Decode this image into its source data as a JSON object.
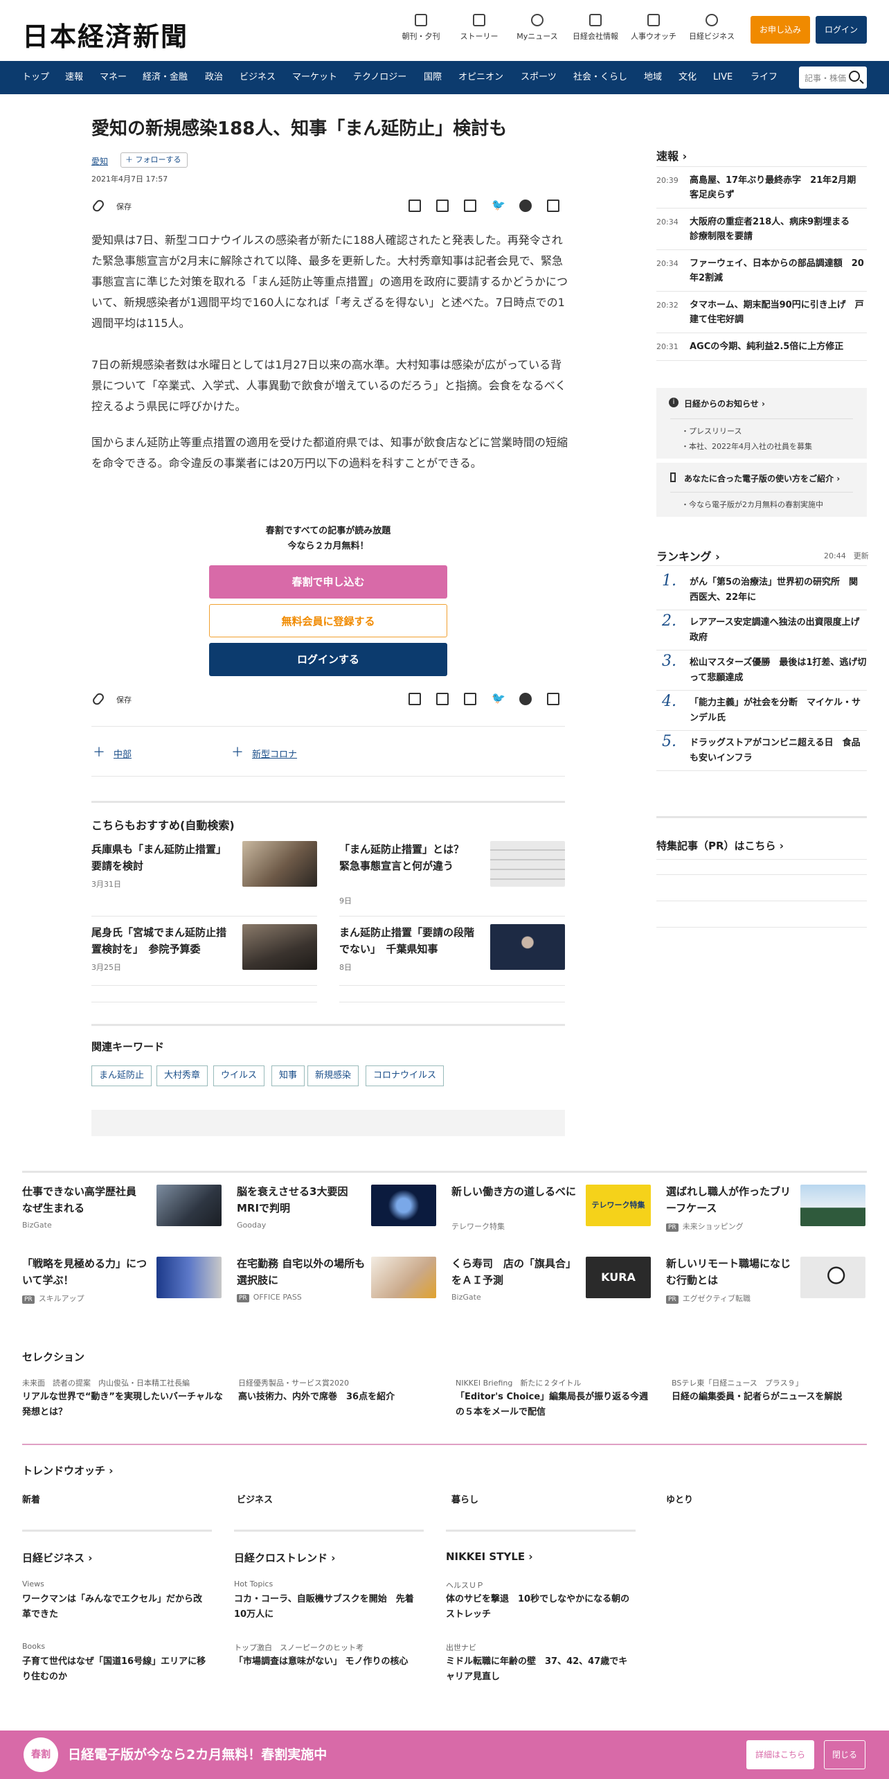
{
  "header": {
    "logo": "日本経済新聞",
    "icons": [
      {
        "label": "朝刊・夕刊"
      },
      {
        "label": "ストーリー"
      },
      {
        "label": "Myニュース"
      },
      {
        "label": "日経会社情報"
      },
      {
        "label": "人事ウオッチ"
      },
      {
        "label": "日経ビジネス"
      }
    ],
    "apply_label": "お申し込み",
    "login_label": "ログイン"
  },
  "nav": {
    "items": [
      "トップ",
      "速報",
      "マネー",
      "経済・金融",
      "政治",
      "ビジネス",
      "マーケット",
      "テクノロジー",
      "国際",
      "オピニオン",
      "スポーツ",
      "社会・くらし",
      "地域",
      "文化",
      "LIVE",
      "ライフ"
    ],
    "search_placeholder": "記事・株価"
  },
  "article": {
    "headline": "愛知の新規感染188人、知事「まん延防止」検討も",
    "topic": "愛知",
    "follow": "フォローする",
    "date": "2021年4月7日 17:57",
    "save": "保存",
    "paragraphs": [
      "愛知県は7日、新型コロナウイルスの感染者が新たに188人確認されたと発表した。再発令された緊急事態宣言が2月末に解除されて以降、最多を更新した。大村秀章知事は記者会見で、緊急事態宣言に準じた対策を取れる「まん延防止等重点措置」の適用を政府に要請するかどうかについて、新規感染者が1週間平均で160人になれば「考えざるを得ない」と述べた。7日時点での1週間平均は115人。",
      "7日の新規感染者数は水曜日としては1月27日以来の高水準。大村知事は感染が広がっている背景について「卒業式、入学式、人事異動で飲食が増えているのだろう」と指摘。会食をなるべく控えるよう県民に呼びかけた。",
      "国からまん延防止等重点措置の適用を受けた都道府県では、知事が飲食店などに営業時間の短縮を命令できる。命令違反の事業者には20万円以下の過料を科すことができる。"
    ],
    "paywall": {
      "line1": "春割ですべての記事が読み放題",
      "line2": "今なら２カ月無料！",
      "btn1": "春割で申し込む",
      "btn2": "無料会員に登録する",
      "btn3": "ログインする"
    },
    "topics": [
      "中部",
      "新型コロナ"
    ]
  },
  "recommend": {
    "title": "こちらもおすすめ(自動検索)",
    "items": [
      {
        "title": "兵庫県も「まん延防止措置」要請を検討",
        "date": "3月31日"
      },
      {
        "title": "「まん延防止措置」とは？　緊急事態宣言と何が違う",
        "date": "9日"
      },
      {
        "title": "尾身氏「宮城でまん延防止措置検討を」　参院予算委",
        "date": "3月25日"
      },
      {
        "title": "まん延防止措置「要請の段階でない」　千葉県知事",
        "date": "8日"
      }
    ]
  },
  "keywords": {
    "title": "関連キーワード",
    "items": [
      "まん延防止",
      "大村秀章",
      "ウイルス",
      "知事",
      "新規感染",
      "コロナウイルス"
    ]
  },
  "sidebar": {
    "news_title": "速報",
    "news": [
      {
        "time": "20:39",
        "text": "高島屋、17年ぶり最終赤字　21年2月期　客足戻らず"
      },
      {
        "time": "20:34",
        "text": "大阪府の重症者218人、病床9割埋まる　診療制限を要請"
      },
      {
        "time": "20:34",
        "text": "ファーウェイ、日本からの部品調達額　20年2割減"
      },
      {
        "time": "20:32",
        "text": "タマホーム、期末配当90円に引き上げ　戸建て住宅好調"
      },
      {
        "time": "20:31",
        "text": "AGCの今期、純利益2.5倍に上方修正"
      }
    ],
    "notice": {
      "title": "日経からのお知らせ",
      "items": [
        "プレスリリース",
        "本社、2022年4月入社の社員を募集"
      ]
    },
    "guide": {
      "title": "あなたに合った電子版の使い方をご紹介",
      "items": [
        "今なら電子版が2カ月無料の春割実施中"
      ]
    },
    "ranking_title": "ランキング",
    "ranking_time": "20:44",
    "ranking_update": "更新",
    "ranking": [
      {
        "num": "1.",
        "text": "がん「第5の治療法」世界初の研究所　関西医大、22年に"
      },
      {
        "num": "2.",
        "text": "レアアース安定調達へ独法の出資限度上げ　政府"
      },
      {
        "num": "3.",
        "text": "松山マスターズ優勝　最後は1打差、逃げ切って悲願達成"
      },
      {
        "num": "4.",
        "text": "「能力主義」が社会を分断　マイケル・サンデル氏"
      },
      {
        "num": "5.",
        "text": "ドラッグストアがコンビニ超える日　食品も安いインフラ"
      }
    ],
    "special": "特集記事（PR）はこちら"
  },
  "ads": [
    {
      "title": "仕事できない高学歴社員　なぜ生まれる",
      "src": "BizGate",
      "pr": false
    },
    {
      "title": "脳を衰えさせる3大要因　MRIで判明",
      "src": "Gooday",
      "pr": false
    },
    {
      "title": "新しい働き方の道しるべに",
      "src": "テレワーク特集",
      "pr": false
    },
    {
      "title": "選ばれし職人が作ったブリーフケース",
      "src": "未来ショッピング",
      "pr": true
    },
    {
      "title": "「戦略を見極める力」について学ぶ！",
      "src": "スキルアップ",
      "pr": true
    },
    {
      "title": "在宅勤務 自宅以外の場所も選択肢に",
      "src": "OFFICE PASS",
      "pr": true
    },
    {
      "title": "くら寿司　店の「旗具合」をＡＩ予測",
      "src": "BizGate",
      "pr": false
    },
    {
      "title": "新しいリモート職場になじむ行動とは",
      "src": "エグゼクティブ転職",
      "pr": true
    }
  ],
  "ad_thumb_text": {
    "telework": "テレワーク特集",
    "kura": "KURA"
  },
  "selection": {
    "title": "セレクション",
    "items": [
      {
        "cap": "未来面　読者の提案　内山俊弘・日本精工社長編",
        "title": "リアルな世界で“動き”を実現したいバーチャルな発想とは？"
      },
      {
        "cap": "日経優秀製品・サービス賞2020",
        "title": "高い技術力、内外で席巻　36点を紹介"
      },
      {
        "cap": "NIKKEI Briefing　新たに２タイトル",
        "title": "「Editor's Choice」編集局長が振り返る今週の５本をメールで配信"
      },
      {
        "cap": "BSテレ東「日経ニュース　プラス９」",
        "title": "日経の編集委員・記者らがニュースを解説"
      }
    ]
  },
  "trend": {
    "title": "トレンドウオッチ",
    "tabs": [
      "新着",
      "ビジネス",
      "暮らし",
      "ゆとり"
    ]
  },
  "media": [
    {
      "title": "日経ビジネス",
      "items": [
        {
          "cap": "Views",
          "title": "ワークマンは「みんなでエクセル」だから改革できた"
        },
        {
          "cap": "Books",
          "title": "子育て世代はなぜ「国道16号線」エリアに移り住むのか"
        }
      ]
    },
    {
      "title": "日経クロストレンド",
      "items": [
        {
          "cap": "Hot Topics",
          "title": "コカ・コーラ、自販機サブスクを開始　先着10万人に"
        },
        {
          "cap": "トップ激白　スノーピークのヒット考",
          "title": "「市場調査は意味がない」 モノ作りの核心"
        }
      ]
    },
    {
      "title": "NIKKEI STYLE",
      "items": [
        {
          "cap": "ヘルスＵＰ",
          "title": "体のサビを撃退　10秒でしなやかになる朝のストレッチ"
        },
        {
          "cap": "出世ナビ",
          "title": "ミドル転職に年齢の壁　37、42、47歳でキャリア見直し"
        }
      ]
    }
  ],
  "banner": {
    "logo": "春割",
    "text": "日経電子版が今なら2カ月無料！春割実施中",
    "detail": "詳細はこちら",
    "close": "閉じる"
  },
  "colors": {
    "navy": "#0c3b6e",
    "orange": "#f08a00",
    "pink": "#d86aa8"
  }
}
